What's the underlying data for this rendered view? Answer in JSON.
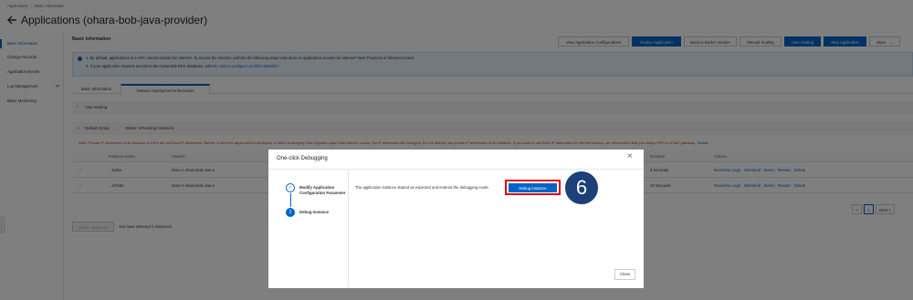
{
  "breadcrumb": {
    "root": "Applications",
    "separator": "/",
    "current": "Basic Information"
  },
  "page_title": "Applications (ohara-bob-java-provider)",
  "sidebar": {
    "items": [
      {
        "label": "Basic Information",
        "active": true
      },
      {
        "label": "Change Records"
      },
      {
        "label": "Application Events"
      },
      {
        "label": "Log Management",
        "has_chevron": true
      },
      {
        "label": "Basic Monitoring"
      }
    ]
  },
  "section_title": "Basic Information",
  "toolbar": {
    "view_config": "View Application Configurations",
    "deploy": "Deploy Application",
    "back_earlier": "Back to Earlier Version",
    "manual_scaling": "Manual Scaling",
    "auto_scaling": "Auto Scaling",
    "stop": "Stop Application",
    "more": "More"
  },
  "notice": {
    "line1": "1. By default, applications in a VPC cannot access the Internet. To access the Internet, perform the following steps:How does an application access the Internet? Best Practices of Internet Access",
    "line2_prefix": "2. If your application requires access to the ApsaraDB RDS database, refer to",
    "line2_link": "How to configure an RDS whitelist?"
  },
  "tabs": {
    "basic": "Basic Information",
    "instance": "Instance Deployment Information"
  },
  "auto_scaling_label": "Auto Scaling",
  "group": {
    "name": "Default Group",
    "status": "Status: 8 Running Instances"
  },
  "warning": "Note: Private IP addresses of an instance or EIPs are not fixed IP addresses. Before or after the application is deployed, or when underlying host migration upon host failover occurs, the IP addresses are changed. Do not directly use private IP addresses of an instance. If you want to use fixed IP addresses for Internet access, we recommend that you assign EIPs to a NAT gateway.",
  "warning_link": "Details",
  "table": {
    "headers": {
      "name": "Instance Name",
      "vswitch": "vSwitch",
      "duration": "Duration",
      "actions": "Actions"
    },
    "rows": [
      {
        "dash": "--",
        "name": "...fu4bu",
        "vswitch": "Zone A ohara-bob-vsw-a",
        "duration": "8 Seconds"
      },
      {
        "dash": "--",
        "name": "...m7b8s",
        "vswitch": "Zone A ohara-bob-vsw-a",
        "duration": "10 Seconds"
      }
    ],
    "actions": {
      "logs": "Real-time Logs",
      "webshell": "Webshell",
      "event": "Event",
      "restart": "Restart",
      "delete": "Delete"
    }
  },
  "pagination": {
    "prev": "<",
    "page": "1",
    "next": "Next >"
  },
  "bottom": {
    "delete_btn": "Delete Instances",
    "selected": "You have selected 0 instances."
  },
  "modal": {
    "title": "One-click Debugging",
    "close_icon": "×",
    "steps": [
      {
        "num": "✓",
        "label": "Modify Application Configuration Parameter"
      },
      {
        "num": "2",
        "label": "Debug Instance"
      }
    ],
    "message": "The application instance started as expected and entered the debugging mode.",
    "debug_button": "Debug Instance",
    "close_button": "Close"
  },
  "step_marker": "6",
  "colors": {
    "primary": "#0064c8",
    "highlight": "#e00000",
    "marker": "#1d3f7a"
  }
}
